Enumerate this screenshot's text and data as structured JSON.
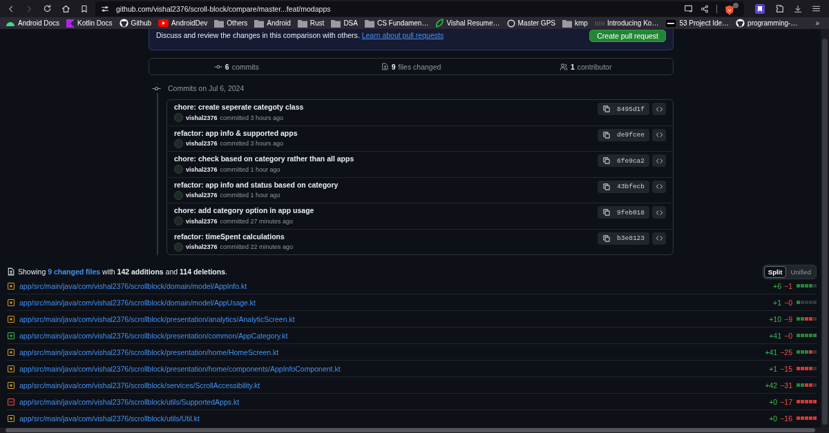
{
  "browser": {
    "url": "github.com/vishal2376/scroll-block/compare/master...feat/modapps",
    "bookmarks": [
      {
        "label": "Android Docs"
      },
      {
        "label": "Kotlin Docs"
      },
      {
        "label": "Github"
      },
      {
        "label": "AndroidDev"
      },
      {
        "label": "Others"
      },
      {
        "label": "Android"
      },
      {
        "label": "Rust"
      },
      {
        "label": "DSA"
      },
      {
        "label": "CS Fundamen…"
      },
      {
        "label": "Vishal Resume…"
      },
      {
        "label": "Master GPS"
      },
      {
        "label": "kmp"
      },
      {
        "label": "Introducing Ko…"
      },
      {
        "label": "53 Project Ide…"
      },
      {
        "label": "programming-…"
      }
    ],
    "more": "»"
  },
  "banner": {
    "text": "Discuss and review the changes in this comparison with others.",
    "link": "Learn about pull requests",
    "button": "Create pull request"
  },
  "summary": [
    {
      "kind": "commits",
      "count": "6",
      "label": "commits"
    },
    {
      "kind": "files",
      "count": "9",
      "label": "files changed"
    },
    {
      "kind": "contributors",
      "count": "1",
      "label": "contributor"
    }
  ],
  "commits_heading": "Commits on Jul 6, 2024",
  "commits": [
    {
      "title": "chore: create seperate categoty class",
      "author": "vishal2376",
      "time": "committed 3 hours ago",
      "sha": "8495d1f"
    },
    {
      "title": "refactor: app info & supported apps",
      "author": "vishal2376",
      "time": "committed 3 hours ago",
      "sha": "de9fcee"
    },
    {
      "title": "chore: check based on category rather than all apps",
      "author": "vishal2376",
      "time": "committed 1 hour ago",
      "sha": "6fe9ca2"
    },
    {
      "title": "refactor: app info and status based on category",
      "author": "vishal2376",
      "time": "committed 1 hour ago",
      "sha": "43bfecb"
    },
    {
      "title": "chore: add category option in app usage",
      "author": "vishal2376",
      "time": "committed 27 minutes ago",
      "sha": "9feb018"
    },
    {
      "title": "refactor: timeSpent calculations",
      "author": "vishal2376",
      "time": "committed 22 minutes ago",
      "sha": "b3e8123"
    }
  ],
  "files_summary": {
    "prefix": "Showing",
    "link": "9 changed files",
    "rest": "with **142 additions** and **114 deletions**."
  },
  "view_toggle": [
    {
      "label": "Split",
      "selected": true
    },
    {
      "label": "Unified",
      "selected": false
    }
  ],
  "files": [
    {
      "path": "app/src/main/java/com/vishal2376/scrollblock/domain/model/AppInfo.kt",
      "kind": "modified",
      "additions": "+6",
      "deletions": "−1"
    },
    {
      "path": "app/src/main/java/com/vishal2376/scrollblock/domain/model/AppUsage.kt",
      "kind": "modified",
      "additions": "+1",
      "deletions": "−0"
    },
    {
      "path": "app/src/main/java/com/vishal2376/scrollblock/presentation/analytics/AnalyticScreen.kt",
      "kind": "modified",
      "additions": "+10",
      "deletions": "−9"
    },
    {
      "path": "app/src/main/java/com/vishal2376/scrollblock/presentation/common/AppCategory.kt",
      "kind": "added",
      "additions": "+41",
      "deletions": "−0"
    },
    {
      "path": "app/src/main/java/com/vishal2376/scrollblock/presentation/home/HomeScreen.kt",
      "kind": "modified",
      "additions": "+41",
      "deletions": "−25"
    },
    {
      "path": "app/src/main/java/com/vishal2376/scrollblock/presentation/home/components/AppInfoComponent.kt",
      "kind": "modified",
      "additions": "+1",
      "deletions": "−15"
    },
    {
      "path": "app/src/main/java/com/vishal2376/scrollblock/services/ScrollAccessibility.kt",
      "kind": "modified",
      "additions": "+42",
      "deletions": "−31"
    },
    {
      "path": "app/src/main/java/com/vishal2376/scrollblock/utils/SupportedApps.kt",
      "kind": "removed",
      "additions": "+0",
      "deletions": "−17"
    },
    {
      "path": "app/src/main/java/com/vishal2376/scrollblock/utils/Util.kt",
      "kind": "modified",
      "additions": "+0",
      "deletions": "−16"
    }
  ]
}
